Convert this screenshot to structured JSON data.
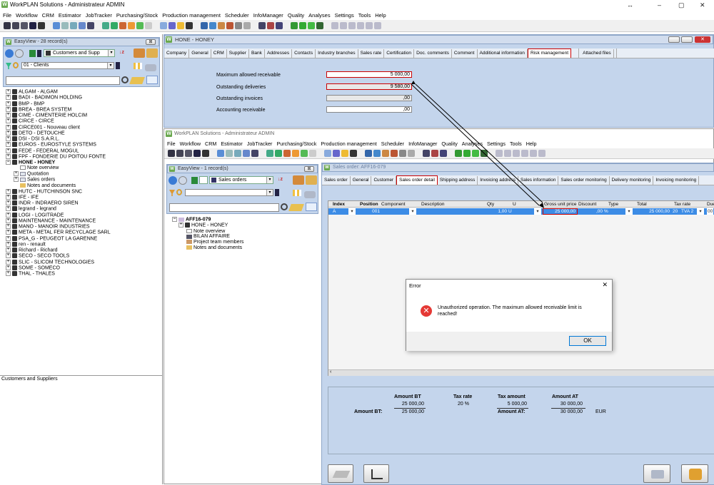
{
  "app": {
    "title": "WorkPLAN Solutions - Administrateur ADMIN",
    "logo": "W",
    "window_controls": [
      "↔",
      "–",
      "▢",
      "✕"
    ]
  },
  "menu": [
    "File",
    "Workflow",
    "CRM",
    "Estimator",
    "JobTracker",
    "Purchasing/Stock",
    "Production management",
    "Scheduler",
    "InfoManager",
    "Quality",
    "Analyses",
    "Settings",
    "Tools",
    "Help"
  ],
  "easyview1": {
    "title": "EasyView - 28 record(s)",
    "combo": "Customers and Supp",
    "filter": "01 - Clients",
    "items": [
      "ALGAM - ALGAM",
      "BADI - BADIMON HOLDING",
      "BMP - BMP",
      "BREA - BREA SYSTEM",
      "CIME - CIMENTERIE HOLCIM",
      "CIRCE - CIRCE",
      "CIRCE001 - Nouveau client",
      "DETO - DETOUCHE",
      "DSI - DSI S.A.R.L.",
      "EUROS - EUROSTYLE SYSTEMS",
      "FEDE - FEDERAL MOGUL",
      "FPF - FONDERIE DU POITOU FONTE",
      "HONE - HONEY"
    ],
    "hone_children": [
      "Note overview",
      "Quotation",
      "Sales orders",
      "Notes and documents"
    ],
    "items2": [
      "HUTC - HUTCHINSON SNC",
      "IFE - IFE",
      "INDR - INDRAERO SIREN",
      "legrand - legrand",
      "LOGI - LOGITRADE",
      "MAINTENANCE - MAINTENANCE",
      "MANO - MANOIR INDUSTRIES",
      "META - METAL FER RECYCLAGE SARL",
      "PSA_G - PEUGEOT LA GARENNE",
      "ren - renault",
      "Richard - Richard",
      "SECO - SECO TOOLS",
      "SLIC - SLICOM TECHNOLOGIES",
      "SOME - SOMECO",
      "THAL - THALES"
    ],
    "footer": "Customers and Suppliers"
  },
  "hone": {
    "title": "HONE - HONEY",
    "tabs": [
      "Company",
      "General",
      "CRM",
      "Supplier",
      "Bank",
      "Addresses",
      "Contacts",
      "Industry branches",
      "Sales rate",
      "Certification",
      "Doc. comments",
      "Comment",
      "Additional information",
      "Risk management",
      "Attached files"
    ],
    "fields": {
      "max_label": "Maximum allowed receivable",
      "max_value": "5 000,00",
      "out_del_label": "Outstanding deliveries",
      "out_del_value": "9 580,00",
      "out_inv_label": "Outstanding invoices",
      "out_inv_value": ",00",
      "acc_label": "Accounting receivable",
      "acc_value": ",00"
    }
  },
  "inner": {
    "title": "WorkPLAN Solutions - Administrateur ADMIN",
    "easyview": {
      "title": "EasyView - 1 record(s)",
      "combo": "Sales orders",
      "root": "AFF16-079",
      "children": [
        "HONE - HONEY",
        "Note overview",
        "BILAN AFFAIRE",
        "Project team members",
        "Notes and documents"
      ]
    },
    "order": {
      "title": "Sales order: AFF16-079",
      "tabs": [
        "Sales order",
        "General",
        "Customer",
        "Sales order detail",
        "Shipping address",
        "Invoicing address",
        "Sales information",
        "Sales order monitoring",
        "Delivery monitoring",
        "Invoicing monitoring"
      ],
      "columns": [
        "Index",
        "Position",
        "Component",
        "Description",
        "Qty",
        "U",
        "Gross unit price",
        "Discount",
        "Type",
        "Total",
        "Tax rate",
        "Due"
      ],
      "row": {
        "index": "A",
        "position": "001",
        "qty": "1,00",
        "unit": "U",
        "price": "25 000,00",
        "discount": ",00",
        "type": "%",
        "total": "25 000,00",
        "tax": "20",
        "tax_code": "TVA 2",
        "due": "00"
      },
      "totals": {
        "amount_bt_h": "Amount BT",
        "tax_rate_h": "Tax rate",
        "tax_amount_h": "Tax amount",
        "amount_at_h": "Amount AT",
        "bt": "25 000,00",
        "rate": "20 %",
        "tax": "5 000,00",
        "at": "30 000,00",
        "bt_label": "Amount BT:",
        "bt_total": "25 000,00",
        "at_label": "Amount AT:",
        "at_total": "30 000,00",
        "currency": "EUR"
      }
    }
  },
  "dialog": {
    "title": "Error",
    "close": "✕",
    "message": "Unauthorized operation. The maximum allowed receivable limit is reached!",
    "ok": "OK",
    "icon": "error-icon"
  }
}
